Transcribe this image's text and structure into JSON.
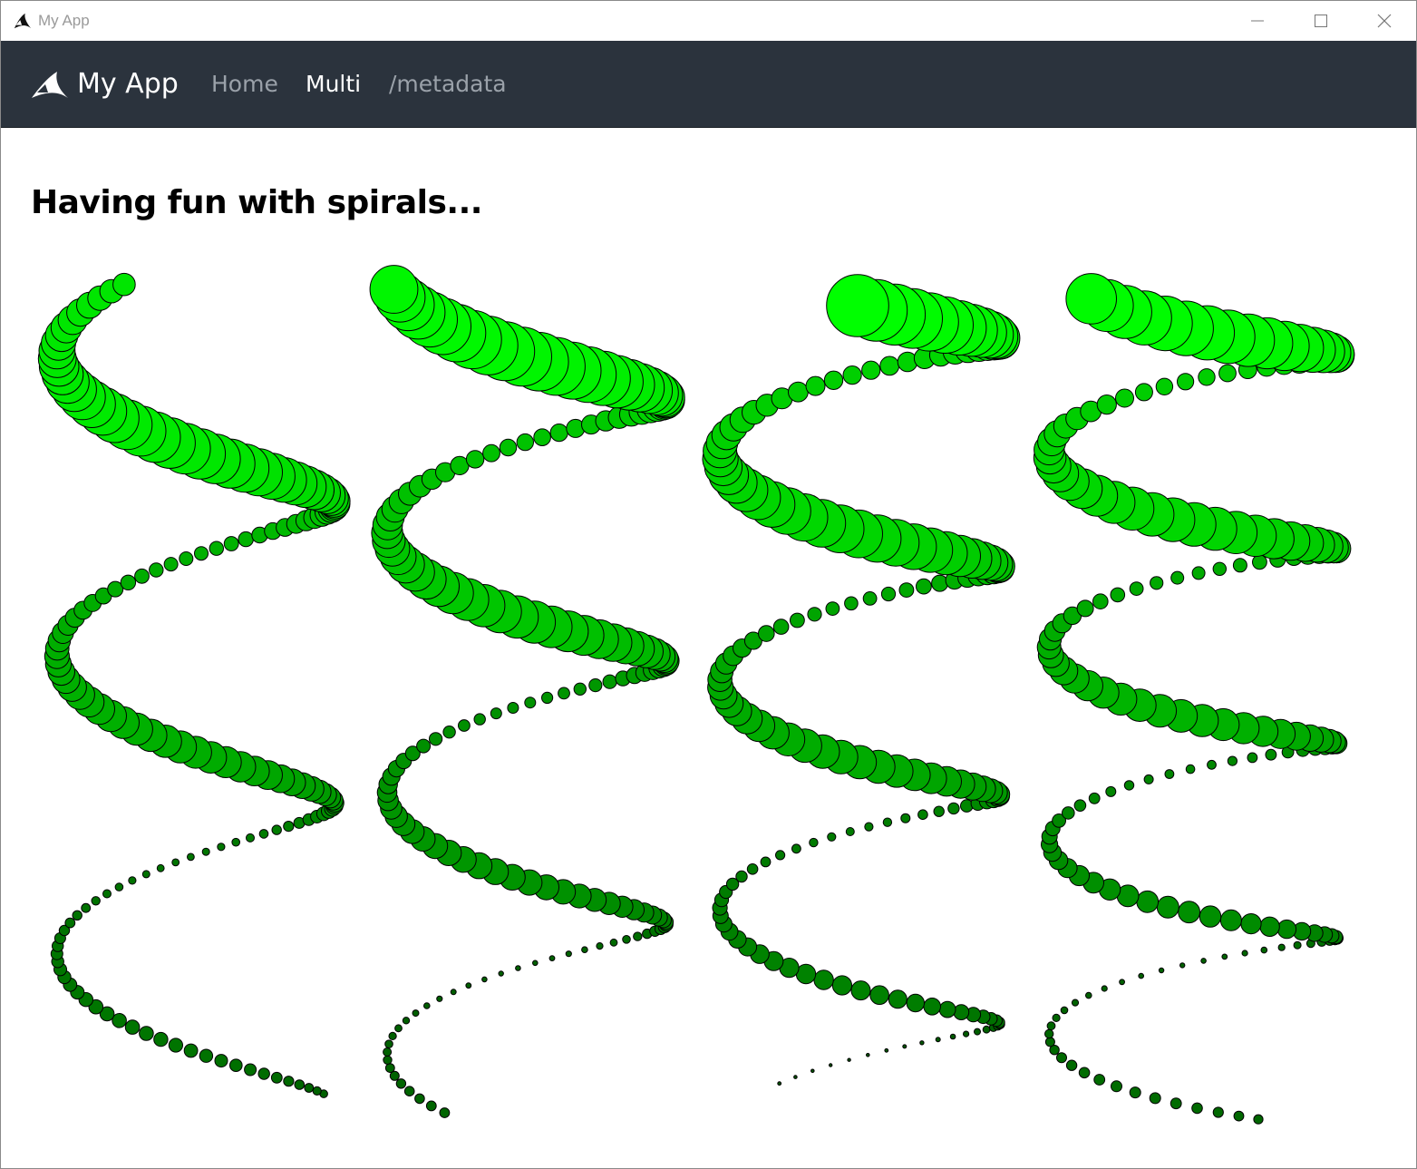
{
  "window": {
    "title": "My App",
    "icon": "shark-fin-icon",
    "controls": [
      "minimize-icon",
      "maximize-icon",
      "close-icon"
    ]
  },
  "navbar": {
    "brand_logo": "shark-fin-logo",
    "brand_name": "My App",
    "links": [
      {
        "label": "Home",
        "active": false
      },
      {
        "label": "Multi",
        "active": true
      },
      {
        "label": "/metadata",
        "active": false
      }
    ]
  },
  "main": {
    "heading": "Having fun with spirals..."
  },
  "colors": {
    "navbar_bg": "#2b333d",
    "nav_link": "#9aa1a9",
    "nav_link_active": "#ffffff",
    "dot_dark": "#004d00",
    "dot_bright": "#00ff00",
    "dot_stroke": "#000000"
  }
}
